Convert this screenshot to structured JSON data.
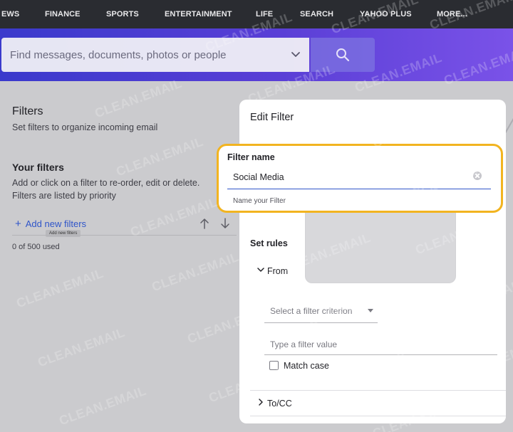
{
  "nav": {
    "items": [
      "EWS",
      "FINANCE",
      "SPORTS",
      "ENTERTAINMENT",
      "LIFE",
      "SEARCH",
      "YAHOO PLUS",
      "MORE..."
    ]
  },
  "search": {
    "placeholder": "Find messages, documents, photos or people"
  },
  "settings": {
    "title": "Filters",
    "subtitle": "Set filters to organize incoming email",
    "your_filters_heading": "Your filters",
    "your_filters_desc": "Add or click on a filter to re-order, edit or delete. Filters are listed by priority",
    "add_new_label": "Add new filters",
    "add_new_tooltip": "Add new filters",
    "used_count": "0 of 500 used"
  },
  "edit_filter": {
    "title": "Edit Filter",
    "name_label": "Filter name",
    "name_value": "Social Media",
    "name_help": "Name your Filter",
    "set_rules_heading": "Set rules",
    "from_label": "From",
    "criterion_placeholder": "Select a filter criterion",
    "value_placeholder": "Type a filter value",
    "match_case_label": "Match case",
    "tocc_label": "To/CC"
  },
  "watermark": {
    "text": "CLEAN.EMAIL"
  },
  "colors": {
    "highlight": "#f2b420",
    "link": "#2f55c9",
    "nav_bg": "#2a2c31"
  }
}
